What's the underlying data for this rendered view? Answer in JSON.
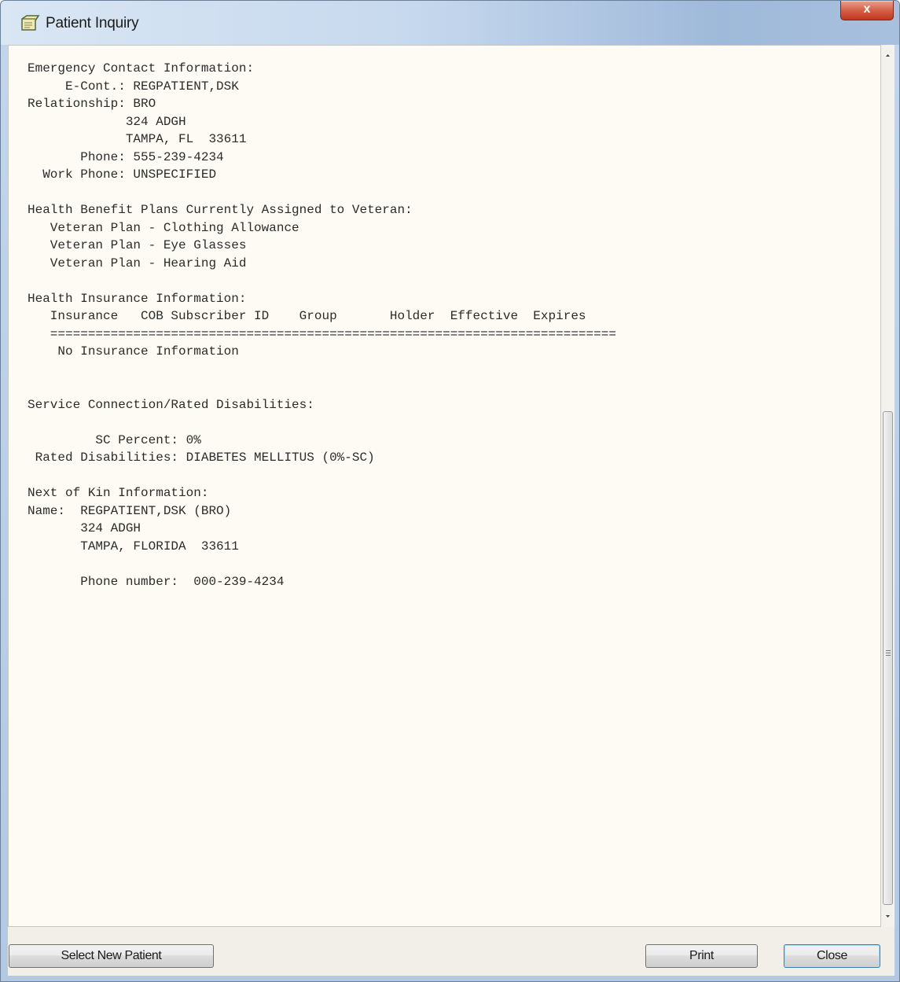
{
  "window": {
    "title": "Patient Inquiry",
    "close_glyph": "x"
  },
  "report": {
    "emergency_contact": {
      "header": "Emergency Contact Information:",
      "econt": "     E-Cont.: REGPATIENT,DSK",
      "relationship": "Relationship: BRO",
      "address1": "             324 ADGH",
      "address2": "             TAMPA, FL  33611",
      "phone": "       Phone: 555-239-4234",
      "work_phone": "  Work Phone: UNSPECIFIED"
    },
    "health_benefit_plans": {
      "header": "Health Benefit Plans Currently Assigned to Veteran:",
      "plans": [
        "   Veteran Plan - Clothing Allowance",
        "   Veteran Plan - Eye Glasses",
        "   Veteran Plan - Hearing Aid"
      ]
    },
    "health_insurance": {
      "header": "Health Insurance Information:",
      "columns": "   Insurance   COB Subscriber ID    Group       Holder  Effective  Expires",
      "separator": "   ===========================================================================",
      "none": "    No Insurance Information"
    },
    "service_connection": {
      "header": "Service Connection/Rated Disabilities:",
      "sc_percent": "         SC Percent: 0%",
      "rated": " Rated Disabilities: DIABETES MELLITUS (0%-SC)"
    },
    "next_of_kin": {
      "header": "Next of Kin Information:",
      "name": "Name:  REGPATIENT,DSK (BRO)",
      "address1": "       324 ADGH",
      "address2": "       TAMPA, FLORIDA  33611",
      "phone": "       Phone number:  000-239-4234"
    }
  },
  "buttons": {
    "select_new_patient": "Select New Patient",
    "print": "Print",
    "close": "Close"
  },
  "icons": {
    "app": "patient-inquiry-icon",
    "close": "close-icon",
    "scroll_up": "scroll-up-arrow-icon",
    "scroll_down": "scroll-down-arrow-icon",
    "scroll_grip": "scroll-grip-icon"
  },
  "colors": {
    "content_background": "#fdfbf3",
    "close_button": "#c0361c",
    "default_button_border": "#3c7fb1"
  }
}
